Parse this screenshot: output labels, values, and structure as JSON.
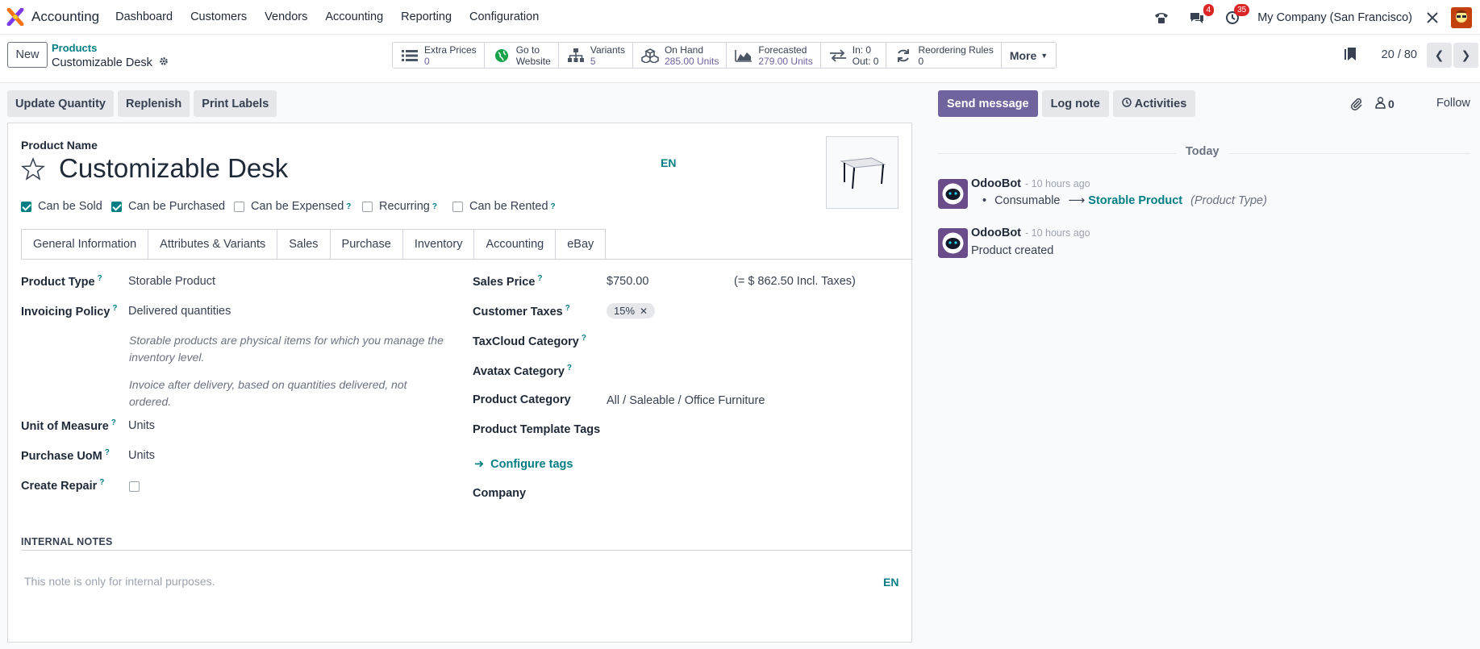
{
  "topnav": {
    "app_name": "Accounting",
    "menu": [
      "Dashboard",
      "Customers",
      "Vendors",
      "Accounting",
      "Reporting",
      "Configuration"
    ],
    "messages_badge": "4",
    "activities_badge": "35",
    "company": "My Company (San Francisco)"
  },
  "control": {
    "new_label": "New",
    "breadcrumb_parent": "Products",
    "breadcrumb_current": "Customizable Desk",
    "smart_buttons": [
      {
        "line1": "Extra Prices",
        "line2": "0",
        "icon": "list-icon"
      },
      {
        "line1": "Go to",
        "line2": "Website",
        "icon": "globe-icon"
      },
      {
        "line1": "Variants",
        "line2": "5",
        "icon": "sitemap-icon"
      },
      {
        "line1": "On Hand",
        "line2": "285.00 Units",
        "icon": "cubes-icon"
      },
      {
        "line1": "Forecasted",
        "line2": "279.00 Units",
        "icon": "area-chart-icon"
      },
      {
        "line1": "In: 0",
        "line2": "Out: 0",
        "icon": "exchange-icon"
      },
      {
        "line1": "Reordering Rules",
        "line2": "0",
        "icon": "refresh-icon"
      }
    ],
    "more_label": "More",
    "pager": "20 / 80"
  },
  "actions": [
    "Update Quantity",
    "Replenish",
    "Print Labels"
  ],
  "form": {
    "product_name_label": "Product Name",
    "product_name": "Customizable Desk",
    "lang": "EN",
    "checkboxes": [
      {
        "label": "Can be Sold",
        "checked": true
      },
      {
        "label": "Can be Purchased",
        "checked": true
      },
      {
        "label": "Can be Expensed",
        "checked": false
      },
      {
        "label": "Recurring",
        "checked": false
      },
      {
        "label": "Can be Rented",
        "checked": false
      }
    ],
    "tabs": [
      "General Information",
      "Attributes & Variants",
      "Sales",
      "Purchase",
      "Inventory",
      "Accounting",
      "eBay"
    ],
    "left": {
      "product_type_label": "Product Type",
      "product_type": "Storable Product",
      "invoicing_policy_label": "Invoicing Policy",
      "invoicing_policy": "Delivered quantities",
      "help1": "Storable products are physical items for which you manage the inventory level.",
      "help2": "Invoice after delivery, based on quantities delivered, not ordered.",
      "uom_label": "Unit of Measure",
      "uom": "Units",
      "purchase_uom_label": "Purchase UoM",
      "purchase_uom": "Units",
      "create_repair_label": "Create Repair"
    },
    "right": {
      "sales_price_label": "Sales Price",
      "sales_price": "$750.00",
      "incl_taxes": "(= $ 862.50 Incl. Taxes)",
      "customer_taxes_label": "Customer Taxes",
      "tax_tag": "15%",
      "taxcloud_label": "TaxCloud Category",
      "avatax_label": "Avatax Category",
      "product_category_label": "Product Category",
      "product_category": "All / Saleable / Office Furniture",
      "template_tags_label": "Product Template Tags",
      "configure_tags": "Configure tags",
      "company_label": "Company"
    },
    "notes_title": "INTERNAL NOTES",
    "notes_placeholder": "This note is only for internal purposes.",
    "notes_lang": "EN"
  },
  "chatter": {
    "send_message": "Send message",
    "log_note": "Log note",
    "activities": "Activities",
    "followers_count": "0",
    "follow": "Follow",
    "today": "Today",
    "messages": [
      {
        "author": "OdooBot",
        "time": "- 10 hours ago",
        "old": "Consumable",
        "new": "Storable Product",
        "field": "(Product Type)"
      },
      {
        "author": "OdooBot",
        "time": "- 10 hours ago",
        "body": "Product created"
      }
    ]
  },
  "colors": {
    "brand": "#71639e",
    "accent": "#017e84",
    "badge": "#dc2626"
  }
}
